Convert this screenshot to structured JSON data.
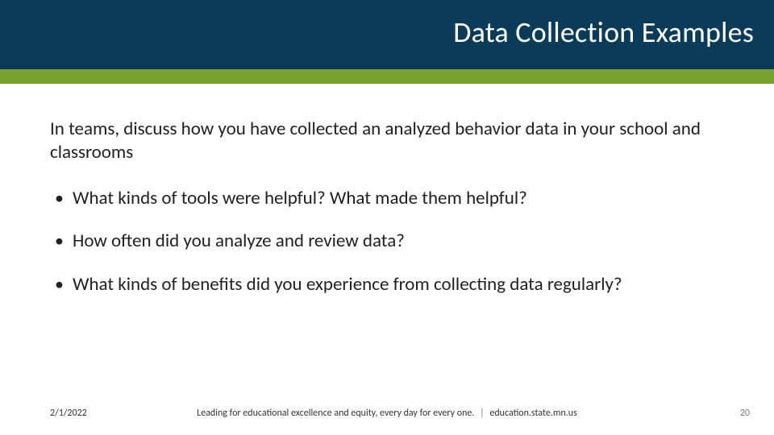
{
  "header": {
    "title": "Data Collection Examples"
  },
  "body": {
    "lead": "In teams, discuss how you have collected an analyzed behavior data in your school and classrooms",
    "bullets": [
      "What kinds of tools were helpful?  What made them helpful?",
      "How often did you analyze and review data?",
      "What kinds of benefits did you experience from collecting data regularly?"
    ]
  },
  "footer": {
    "date": "2/1/2022",
    "tagline": "Leading for educational excellence and equity, every day for every one.",
    "separator": "|",
    "site": "education.state.mn.us",
    "page_number": "20"
  },
  "colors": {
    "header_bg": "#0a3c5a",
    "accent_bg": "#78a22f"
  }
}
